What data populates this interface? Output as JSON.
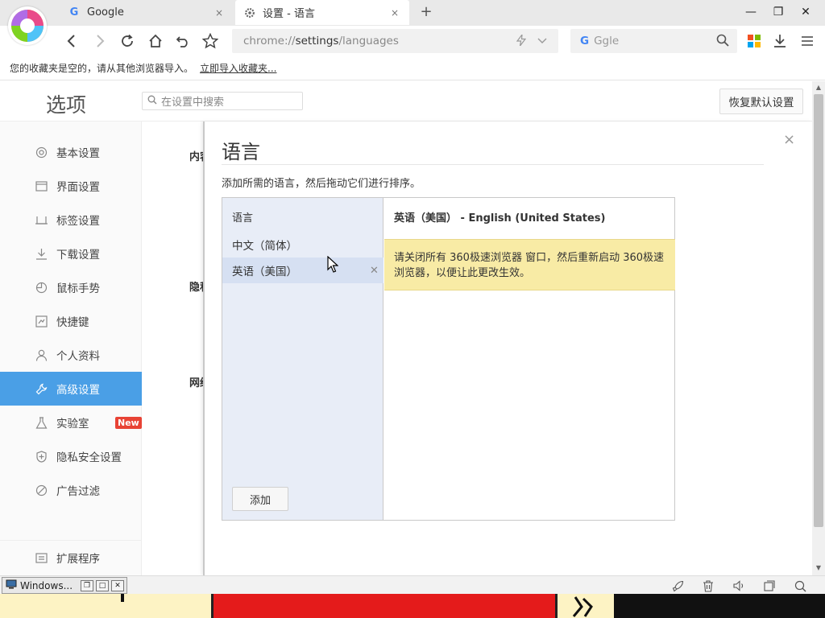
{
  "browser": {
    "tabs": [
      {
        "label": "Google",
        "icon": "google-g-icon",
        "active": false
      },
      {
        "label": "设置 - 语言",
        "icon": "gear-icon",
        "active": true
      }
    ],
    "new_tab_label": "+",
    "address": {
      "prefix": "chrome://",
      "host": "settings",
      "path": "/languages"
    },
    "search_placeholder": "Ggle",
    "search_engine_letter": "G",
    "window_controls": {
      "minimize": "—",
      "restore": "❐",
      "close": "✕"
    },
    "tab_close_glyph": "×"
  },
  "bookmarks_bar": {
    "message": "您的收藏夹是空的，请从其他浏览器导入。",
    "import_link": "立即导入收藏夹..."
  },
  "settings": {
    "page_title": "选项",
    "search_placeholder": "在设置中搜索",
    "restore_button": "恢复默认设置",
    "sidebar": {
      "items": [
        {
          "label": "基本设置",
          "icon": "circle-dot-icon"
        },
        {
          "label": "界面设置",
          "icon": "window-icon"
        },
        {
          "label": "标签设置",
          "icon": "tab-icon"
        },
        {
          "label": "下载设置",
          "icon": "download-icon"
        },
        {
          "label": "鼠标手势",
          "icon": "mouse-icon"
        },
        {
          "label": "快捷键",
          "icon": "keyboard-icon"
        },
        {
          "label": "个人资料",
          "icon": "person-icon"
        },
        {
          "label": "高级设置",
          "icon": "wrench-icon",
          "active": true
        },
        {
          "label": "实验室",
          "icon": "flask-icon",
          "badge": "New"
        },
        {
          "label": "隐私安全设置",
          "icon": "shield-icon"
        },
        {
          "label": "广告过滤",
          "icon": "block-icon"
        }
      ],
      "footer_item": {
        "label": "扩展程序",
        "icon": "extension-icon"
      }
    },
    "content_fragments": [
      "内容",
      "隐私",
      "网络"
    ]
  },
  "language_dialog": {
    "title": "语言",
    "close_glyph": "×",
    "description": "添加所需的语言，然后拖动它们进行排序。",
    "list_header": "语言",
    "languages": [
      {
        "label": "中文（简体）",
        "selected": false
      },
      {
        "label": "英语（美国）",
        "selected": true
      }
    ],
    "remove_glyph": "✕",
    "add_button": "添加",
    "detail_title": "英语（美国） - English (United States)",
    "notice": "请关闭所有 360极速浏览器 窗口，然后重新启动 360极速浏览器，以便让此更改生效。"
  },
  "statusbar": {
    "task_label": "Windows..."
  },
  "colors": {
    "accent": "#4a9fe6",
    "notice_bg": "#f8eba5",
    "badge_red": "#e84335"
  }
}
